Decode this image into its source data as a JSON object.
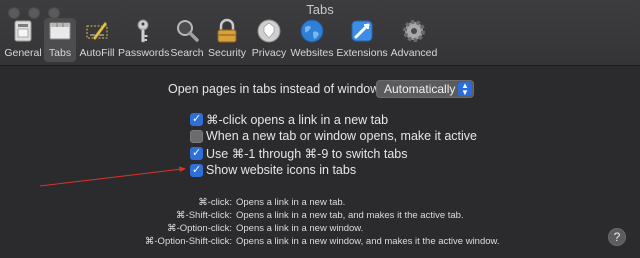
{
  "window": {
    "title": "Tabs"
  },
  "toolbar": {
    "tabs": [
      {
        "label": "General"
      },
      {
        "label": "Tabs"
      },
      {
        "label": "AutoFill"
      },
      {
        "label": "Passwords"
      },
      {
        "label": "Search"
      },
      {
        "label": "Security"
      },
      {
        "label": "Privacy"
      },
      {
        "label": "Websites"
      },
      {
        "label": "Extensions"
      },
      {
        "label": "Advanced"
      }
    ]
  },
  "open_pages": {
    "label": "Open pages in tabs instead of windows:",
    "selected": "Automatically"
  },
  "options": [
    {
      "label": "⌘-click opens a link in a new tab",
      "checked": true
    },
    {
      "label": "When a new tab or window opens, make it active",
      "checked": false
    },
    {
      "label": "Use ⌘-1 through ⌘-9 to switch tabs",
      "checked": true
    },
    {
      "label": "Show website icons in tabs",
      "checked": true
    }
  ],
  "shortcuts": [
    {
      "key": "⌘-click:",
      "desc": "Opens a link in a new tab."
    },
    {
      "key": "⌘-Shift-click:",
      "desc": "Opens a link in a new tab, and makes it the active tab."
    },
    {
      "key": "⌘-Option-click:",
      "desc": "Opens a link in a new window."
    },
    {
      "key": "⌘-Option-Shift-click:",
      "desc": "Opens a link in a new window, and makes it the active window."
    }
  ],
  "help": {
    "label": "?"
  },
  "colors": {
    "accent": "#2e6fd9",
    "annotation_arrow": "#d9342b",
    "background": "#2b2b2d"
  },
  "icons": [
    "general-icon",
    "tabs-icon",
    "autofill-icon",
    "passwords-icon",
    "search-icon",
    "security-icon",
    "privacy-icon",
    "websites-icon",
    "extensions-icon",
    "advanced-icon"
  ]
}
